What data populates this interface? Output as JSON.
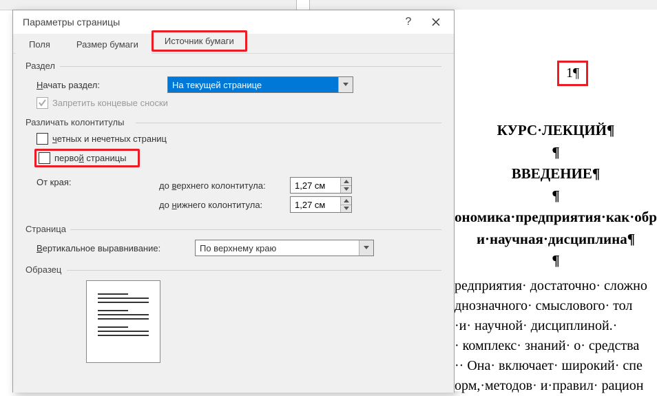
{
  "dialog": {
    "title": "Параметры страницы",
    "help": "?",
    "tabs": [
      "Поля",
      "Размер бумаги",
      "Источник бумаги"
    ],
    "section": {
      "group": "Раздел",
      "start_label_pre": "Н",
      "start_label": "ачать раздел:",
      "start_value": "На текущей странице",
      "suppress": "Запретить концевые сноски"
    },
    "headers": {
      "group": "Различать колонтитулы",
      "odd_even_pre": "ч",
      "odd_even": "етных и нечетных страниц",
      "first_pre": "перво",
      "first_u": "й",
      "first_post": " страницы",
      "from_edge": "От края:",
      "to_header_pre": "до ",
      "to_header_u": "в",
      "to_header_post": "ерхнего колонтитула:",
      "to_footer_pre": "до ",
      "to_footer_u": "н",
      "to_footer_post": "ижнего колонтитула:",
      "header_val": "1,27 см",
      "footer_val": "1,27 см"
    },
    "page": {
      "group": "Страница",
      "valign_u": "В",
      "valign_post": "ертикальное выравнивание:",
      "valign_value": "По верхнему краю"
    },
    "preview": {
      "group": "Образец"
    }
  },
  "doc": {
    "page_num": "1¶",
    "h1": "КУРС·ЛЕКЦИЙ¶",
    "p1": "¶",
    "h2": "ВВЕДЕНИЕ¶",
    "p2": "¶",
    "h3a": "ономика·предприятия·как·обр",
    "h3b": "и·научная·дисциплина¶",
    "p3": "¶",
    "b1": "редприятия· достаточно· сложно",
    "b2": "днозначного· смыслового· тол",
    "b3": "·и· научной· дисциплиной.· ",
    "b4": "· комплекс· знаний· о· средства",
    "b5": "·· Она· включает· широкий· спе",
    "b6": "орм,·методов· и·правил· рацион"
  }
}
